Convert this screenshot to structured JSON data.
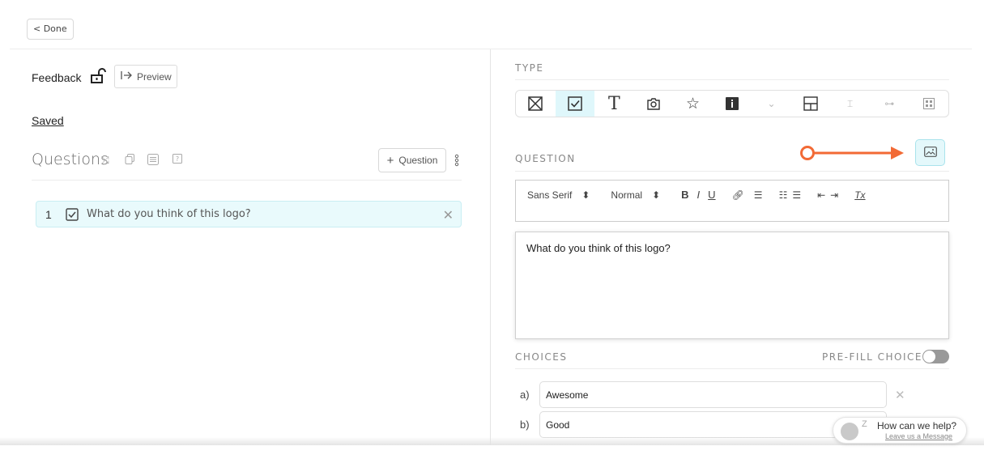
{
  "header": {
    "done_label": "< Done"
  },
  "survey": {
    "title": "Feedback",
    "preview_label": "Preview",
    "saved_label": "Saved",
    "questions_heading": "Questions",
    "add_question_label": "Question"
  },
  "questions": [
    {
      "number": "1",
      "text": "What do you think of this logo?"
    }
  ],
  "editor": {
    "type_label": "TYPE",
    "question_label": "QUESTION",
    "font_family": "Sans Serif",
    "font_size": "Normal",
    "bold": "B",
    "italic": "I",
    "underline": "U",
    "clear_format": "Tx",
    "question_text": "What do you think of this logo?",
    "choices_label": "CHOICES",
    "prefill_label": "PRE-FILL CHOICES?",
    "choices": [
      {
        "letter": "a)",
        "value": "Awesome"
      },
      {
        "letter": "b)",
        "value": "Good"
      }
    ]
  },
  "chat": {
    "title": "How can we help?",
    "subtitle": "Leave us a Message",
    "z": "Z"
  },
  "colors": {
    "accent": "#e9fafc",
    "arrow": "#f26a35",
    "active_type": "#dff7fb"
  }
}
